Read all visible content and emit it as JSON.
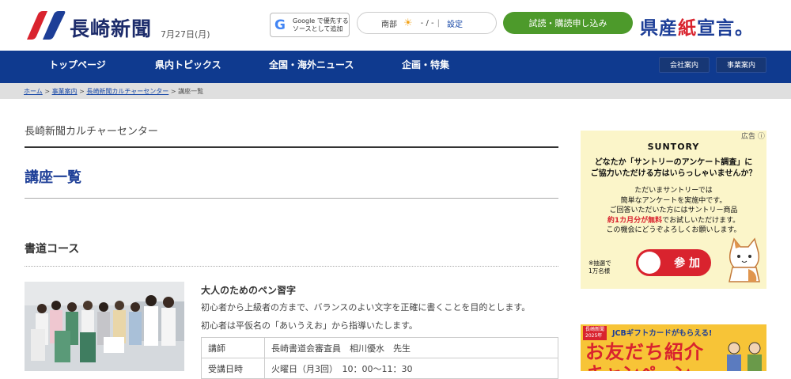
{
  "colors": {
    "brand_navy": "#0f3a8f",
    "accent_blue": "#1d3e97",
    "cta_green": "#4d9a2b",
    "ad_red": "#d9232e"
  },
  "header": {
    "brand_name": "長崎新聞",
    "date": "7月27日(月)",
    "google_btn": {
      "icon": "google-g-icon",
      "line1": "Google で優先する",
      "line2": "ソースとして追加"
    },
    "weather": {
      "region": "南部",
      "icon": "sun-icon",
      "temps": "- / -",
      "settings": "設定"
    },
    "subscribe_btn": "試読・購読申し込み",
    "kensan": {
      "pre": "県産",
      "hi": "紙",
      "post": "宣言。"
    }
  },
  "nav": {
    "items": [
      "トップページ",
      "県内トピックス",
      "全国・海外ニュース",
      "企画・特集"
    ],
    "right_buttons": [
      "会社案内",
      "事業案内"
    ]
  },
  "breadcrumb": {
    "items": [
      "ホーム",
      "事業案内",
      "長崎新聞カルチャーセンター"
    ],
    "current": "講座一覧",
    "sep": ">"
  },
  "main": {
    "subtitle": "長崎新聞カルチャーセンター",
    "title": "講座一覧",
    "section_title": "書道コース",
    "course": {
      "title": "大人のためのペン習字",
      "desc1": "初心者から上級者の方まで、バランスのよい文字を正確に書くことを目的とします。",
      "desc2": "初心者は平仮名の「あいうえお」から指導いたします。",
      "info": [
        {
          "key": "講師",
          "value": "長崎書道会審査員　相川優水　先生"
        },
        {
          "key": "受講日時",
          "value": "火曜日（月3回）　10：00〜11：30"
        }
      ]
    }
  },
  "ad1": {
    "label": "広告",
    "brand": "SUNTORY",
    "q1": "どなたか「サントリーのアンケート調査」に",
    "q2": "ご協力いただける方はいらっしゃいませんか？",
    "b1": "ただいまサントリーでは",
    "b2": "簡単なアンケートを実施中です。",
    "b3": "ご回答いただいた方にはサントリー商品",
    "b4_red": "約1カ月分が無料",
    "b4_rest": "でお試しいただけます。",
    "b5": "この機会にどうぞよろしくお願いします。",
    "note1": "※抽選で",
    "note2": "1万名様",
    "join": "参 加"
  },
  "ad2": {
    "badge1": "長崎新聞",
    "badge2": "2025年",
    "headline": "JCBギフトカードがもらえる!",
    "big": "お友だち紹介",
    "big2": "キャンペーン"
  }
}
